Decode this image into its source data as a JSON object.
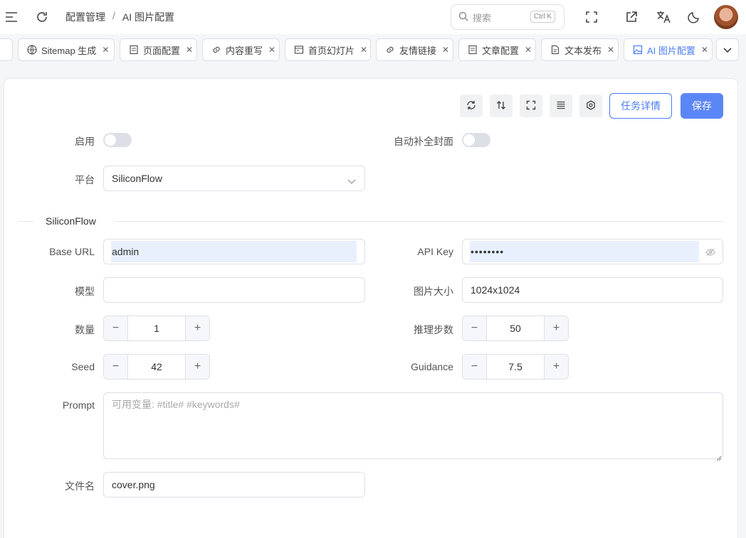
{
  "header": {
    "breadcrumb": [
      "配置管理",
      "AI 图片配置"
    ],
    "breadcrumb_sep": "/",
    "search_placeholder": "搜索",
    "search_shortcut": "Ctrl K"
  },
  "tabs": [
    {
      "label": "Sitemap 生成",
      "icon": "globe-icon",
      "active": false
    },
    {
      "label": "页面配置",
      "icon": "page-icon",
      "active": false
    },
    {
      "label": "内容重写",
      "icon": "link-icon",
      "active": false
    },
    {
      "label": "首页幻灯片",
      "icon": "slides-icon",
      "active": false
    },
    {
      "label": "友情链接",
      "icon": "link-icon",
      "active": false
    },
    {
      "label": "文章配置",
      "icon": "page-icon",
      "active": false
    },
    {
      "label": "文本发布",
      "icon": "doc-icon",
      "active": false
    },
    {
      "label": "AI 图片配置",
      "icon": "image-icon",
      "active": true
    }
  ],
  "toolbar": {
    "task_details": "任务详情",
    "save": "保存"
  },
  "form": {
    "enable_label": "启用",
    "enable_value": false,
    "auto_cover_label": "自动补全封面",
    "auto_cover_value": false,
    "platform_label": "平台",
    "platform_value": "SiliconFlow",
    "section_title": "SiliconFlow",
    "base_url_label": "Base URL",
    "base_url_value": "admin",
    "api_key_label": "API Key",
    "api_key_value": "••••••••",
    "model_label": "模型",
    "model_value": "",
    "image_size_label": "图片大小",
    "image_size_value": "1024x1024",
    "count_label": "数量",
    "count_value": "1",
    "steps_label": "推理步数",
    "steps_value": "50",
    "seed_label": "Seed",
    "seed_value": "42",
    "guidance_label": "Guidance",
    "guidance_value": "7.5",
    "prompt_label": "Prompt",
    "prompt_placeholder": "可用变量: #title# #keywords#",
    "filename_label": "文件名",
    "filename_value": "cover.png"
  },
  "colors": {
    "primary": "#5b86f5",
    "active_tab": "#4c7cf3",
    "autofill": "#e8f0fe"
  }
}
